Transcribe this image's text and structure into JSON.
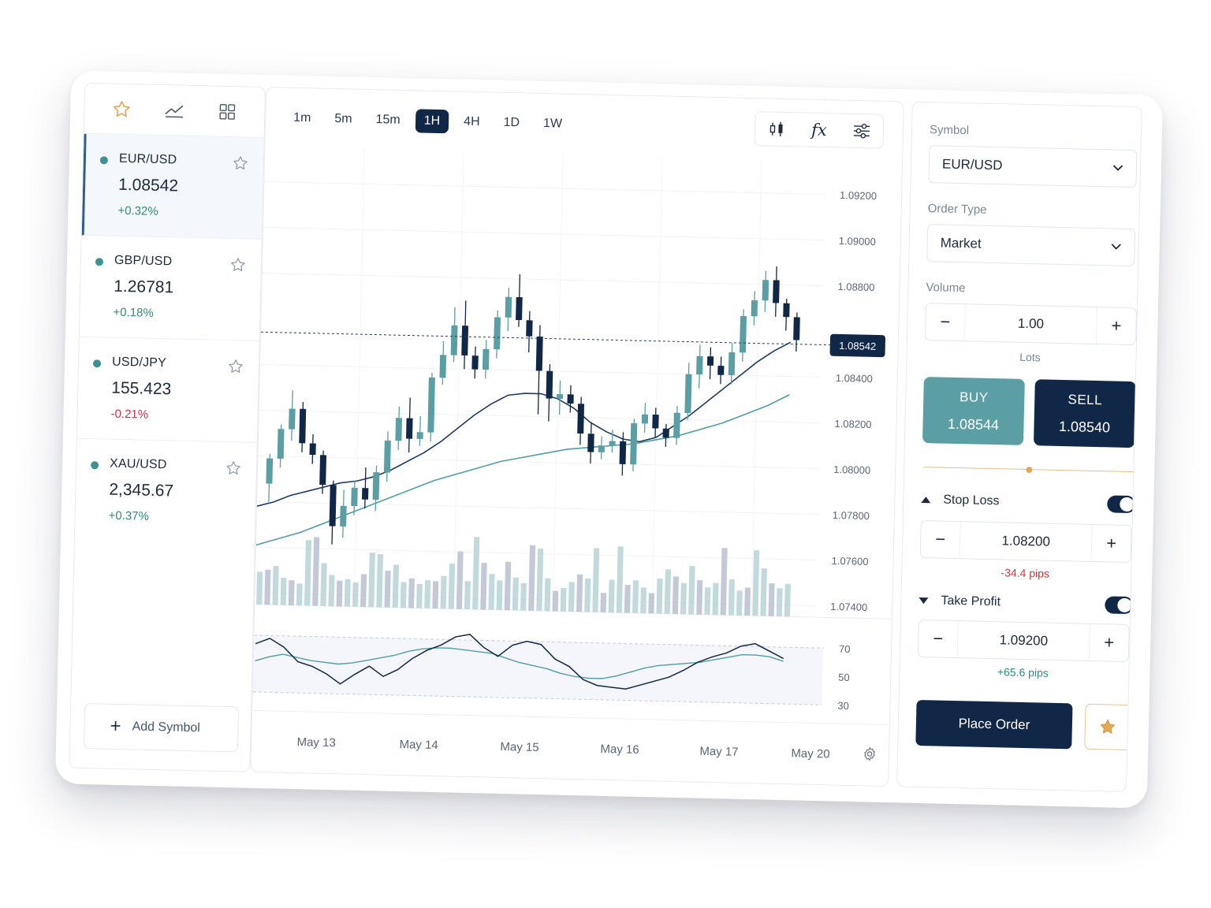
{
  "left_panel": {
    "tabs": [
      {
        "icon": "star-icon"
      },
      {
        "icon": "trend-icon"
      },
      {
        "icon": "grid-icon"
      }
    ],
    "symbols": [
      {
        "name": "EUR/USD",
        "price": "1.08542",
        "change": "+0.32%",
        "direction": "up",
        "active": true
      },
      {
        "name": "GBP/USD",
        "price": "1.26781",
        "change": "+0.18%",
        "direction": "up",
        "active": false
      },
      {
        "name": "USD/JPY",
        "price": "155.423",
        "change": "-0.21%",
        "direction": "down",
        "active": false
      },
      {
        "name": "XAU/USD",
        "price": "2,345.67",
        "change": "+0.37%",
        "direction": "up",
        "active": false
      }
    ],
    "add_symbol_label": "Add Symbol"
  },
  "center_panel": {
    "timeframes": [
      "1m",
      "5m",
      "15m",
      "1H",
      "4H",
      "1D",
      "1W"
    ],
    "active_timeframe": "1H",
    "tools": [
      "candlestick-icon",
      "function-icon",
      "sliders-icon"
    ],
    "function_label": "fx",
    "settings_icon": "gear-icon"
  },
  "chart_data": {
    "type": "candlestick",
    "symbol": "EUR/USD",
    "current_price": "1.08542",
    "price_ticks": [
      "1.09200",
      "1.09000",
      "1.08800",
      "1.08400",
      "1.08200",
      "1.08000",
      "1.07800",
      "1.07600",
      "1.07400"
    ],
    "x_labels": [
      "May 13",
      "May 14",
      "May 15",
      "May 16",
      "May 17",
      "May 20"
    ],
    "ylim": [
      1.0735,
      1.0935
    ],
    "candles": [
      [
        1.0788,
        1.0799,
        1.078,
        1.0801
      ],
      [
        1.0799,
        1.0812,
        1.0795,
        1.0814
      ],
      [
        1.0812,
        1.0821,
        1.0807,
        1.0829
      ],
      [
        1.0821,
        1.0806,
        1.0802,
        1.0824
      ],
      [
        1.0806,
        1.0801,
        1.0797,
        1.081
      ],
      [
        1.0801,
        1.0788,
        1.0784,
        1.0803
      ],
      [
        1.0788,
        1.077,
        1.0762,
        1.079
      ],
      [
        1.077,
        1.0779,
        1.0765,
        1.0786
      ],
      [
        1.0779,
        1.0787,
        1.0775,
        1.079
      ],
      [
        1.0787,
        1.0782,
        1.0778,
        1.0796
      ],
      [
        1.0782,
        1.0794,
        1.0777,
        1.0797
      ],
      [
        1.0794,
        1.0808,
        1.079,
        1.0812
      ],
      [
        1.0808,
        1.0818,
        1.0804,
        1.0823
      ],
      [
        1.0818,
        1.0809,
        1.0803,
        1.0827
      ],
      [
        1.0809,
        1.0812,
        1.0806,
        1.0819
      ],
      [
        1.0812,
        1.0836,
        1.0808,
        1.0838
      ],
      [
        1.0836,
        1.0846,
        1.0833,
        1.0852
      ],
      [
        1.0846,
        1.0859,
        1.0843,
        1.0867
      ],
      [
        1.0859,
        1.0846,
        1.084,
        1.087
      ],
      [
        1.0846,
        1.084,
        1.0836,
        1.085
      ],
      [
        1.084,
        1.0849,
        1.0836,
        1.0853
      ],
      [
        1.0849,
        1.0863,
        1.0845,
        1.0866
      ],
      [
        1.0863,
        1.0872,
        1.0857,
        1.0876
      ],
      [
        1.0872,
        1.0862,
        1.0859,
        1.0882
      ],
      [
        1.0862,
        1.0855,
        1.0848,
        1.0866
      ],
      [
        1.0855,
        1.084,
        1.0821,
        1.086
      ],
      [
        1.084,
        1.0828,
        1.0818,
        1.0843
      ],
      [
        1.0828,
        1.083,
        1.0821,
        1.0836
      ],
      [
        1.083,
        1.0826,
        1.0822,
        1.0834
      ],
      [
        1.0826,
        1.0813,
        1.0808,
        1.0829
      ],
      [
        1.0813,
        1.0805,
        1.08,
        1.0818
      ],
      [
        1.0805,
        1.0808,
        1.0802,
        1.0812
      ],
      [
        1.0808,
        1.081,
        1.0805,
        1.0815
      ],
      [
        1.081,
        1.08,
        1.0795,
        1.0814
      ],
      [
        1.08,
        1.0818,
        1.0797,
        1.082
      ],
      [
        1.0818,
        1.0822,
        1.0814,
        1.0827
      ],
      [
        1.0822,
        1.0816,
        1.0812,
        1.0825
      ],
      [
        1.0816,
        1.0812,
        1.0808,
        1.0818
      ],
      [
        1.0812,
        1.0823,
        1.0809,
        1.0826
      ],
      [
        1.0823,
        1.084,
        1.082,
        1.0845
      ],
      [
        1.084,
        1.0848,
        1.0834,
        1.0853
      ],
      [
        1.0848,
        1.0844,
        1.0838,
        1.0852
      ],
      [
        1.0844,
        1.084,
        1.0836,
        1.0848
      ],
      [
        1.084,
        1.085,
        1.0836,
        1.0854
      ],
      [
        1.085,
        1.0866,
        1.0846,
        1.0869
      ],
      [
        1.0866,
        1.0873,
        1.0862,
        1.0877
      ],
      [
        1.0873,
        1.0882,
        1.0868,
        1.0886
      ],
      [
        1.0882,
        1.0872,
        1.0866,
        1.0888
      ],
      [
        1.0872,
        1.0866,
        1.086,
        1.0874
      ],
      [
        1.0866,
        1.0856,
        1.0851,
        1.0868
      ]
    ],
    "ma_fast": [
      1.0778,
      1.078,
      1.0783,
      1.0785,
      1.0787,
      1.0789,
      1.079,
      1.0792,
      1.0795,
      1.0799,
      1.0803,
      1.0808,
      1.0814,
      1.082,
      1.0825,
      1.0829,
      1.083,
      1.083,
      1.0828,
      1.0824,
      1.0818,
      1.0814,
      1.0811,
      1.081,
      1.0812,
      1.0817,
      1.0822,
      1.0828,
      1.0834,
      1.084,
      1.0846,
      1.0851,
      1.0855
    ],
    "ma_slow": [
      1.0761,
      1.0764,
      1.0767,
      1.0771,
      1.0775,
      1.0779,
      1.0783,
      1.0787,
      1.0791,
      1.0794,
      1.0797,
      1.08,
      1.0802,
      1.0804,
      1.0806,
      1.0807,
      1.0808,
      1.0809,
      1.0811,
      1.0813,
      1.0816,
      1.0819,
      1.0823,
      1.0827,
      1.0832
    ],
    "volume": [
      42,
      45,
      50,
      35,
      32,
      28,
      84,
      88,
      55,
      40,
      33,
      35,
      31,
      42,
      70,
      68,
      47,
      55,
      33,
      38,
      31,
      36,
      35,
      42,
      58,
      74,
      36,
      93,
      60,
      46,
      38,
      62,
      42,
      35,
      84,
      80,
      42,
      26,
      30,
      38,
      48,
      43,
      82,
      25,
      42,
      85,
      36,
      42,
      33,
      26,
      45,
      57,
      48,
      40,
      62,
      44,
      35,
      41,
      86,
      46,
      32,
      36,
      84,
      61,
      42,
      36,
      42
    ],
    "rsi": {
      "ticks": [
        "70",
        "50",
        "30"
      ],
      "levels": [
        70,
        50,
        30
      ],
      "ylim": [
        25,
        75
      ],
      "values": [
        64,
        68,
        62,
        52,
        49,
        44,
        37,
        44,
        50,
        43,
        48,
        56,
        62,
        66,
        72,
        74,
        65,
        59,
        67,
        70,
        68,
        58,
        53,
        44,
        40,
        39,
        38,
        41,
        44,
        47,
        52,
        58,
        62,
        65,
        70,
        72,
        67,
        62
      ],
      "signal": [
        52,
        55,
        57,
        55,
        53,
        52,
        51,
        52,
        54,
        56,
        58,
        61,
        63,
        64,
        64,
        63,
        62,
        61,
        58,
        55,
        53,
        51,
        48,
        46,
        45,
        45,
        47,
        50,
        53,
        55,
        56,
        57,
        58,
        60,
        62,
        64,
        64,
        63,
        60
      ]
    }
  },
  "order_panel": {
    "symbol_label": "Symbol",
    "symbol_value": "EUR/USD",
    "order_type_label": "Order Type",
    "order_type_value": "Market",
    "volume_label": "Volume",
    "volume_value": "1.00",
    "volume_unit": "Lots",
    "buy_label": "BUY",
    "buy_price": "1.08544",
    "sell_label": "SELL",
    "sell_price": "1.08540",
    "slider_level": 0.5,
    "stop_loss": {
      "label": "Stop Loss",
      "enabled": true,
      "value": "1.08200",
      "pips": "-34.4 pips"
    },
    "take_profit": {
      "label": "Take Profit",
      "enabled": true,
      "value": "1.09200",
      "pips": "+65.6 pips"
    },
    "place_order_label": "Place Order",
    "colors": {
      "navy": "#112748",
      "teal": "#5b9ea4",
      "gold": "#e2a957",
      "up": "#2f8a7e",
      "down": "#d0303d"
    }
  }
}
